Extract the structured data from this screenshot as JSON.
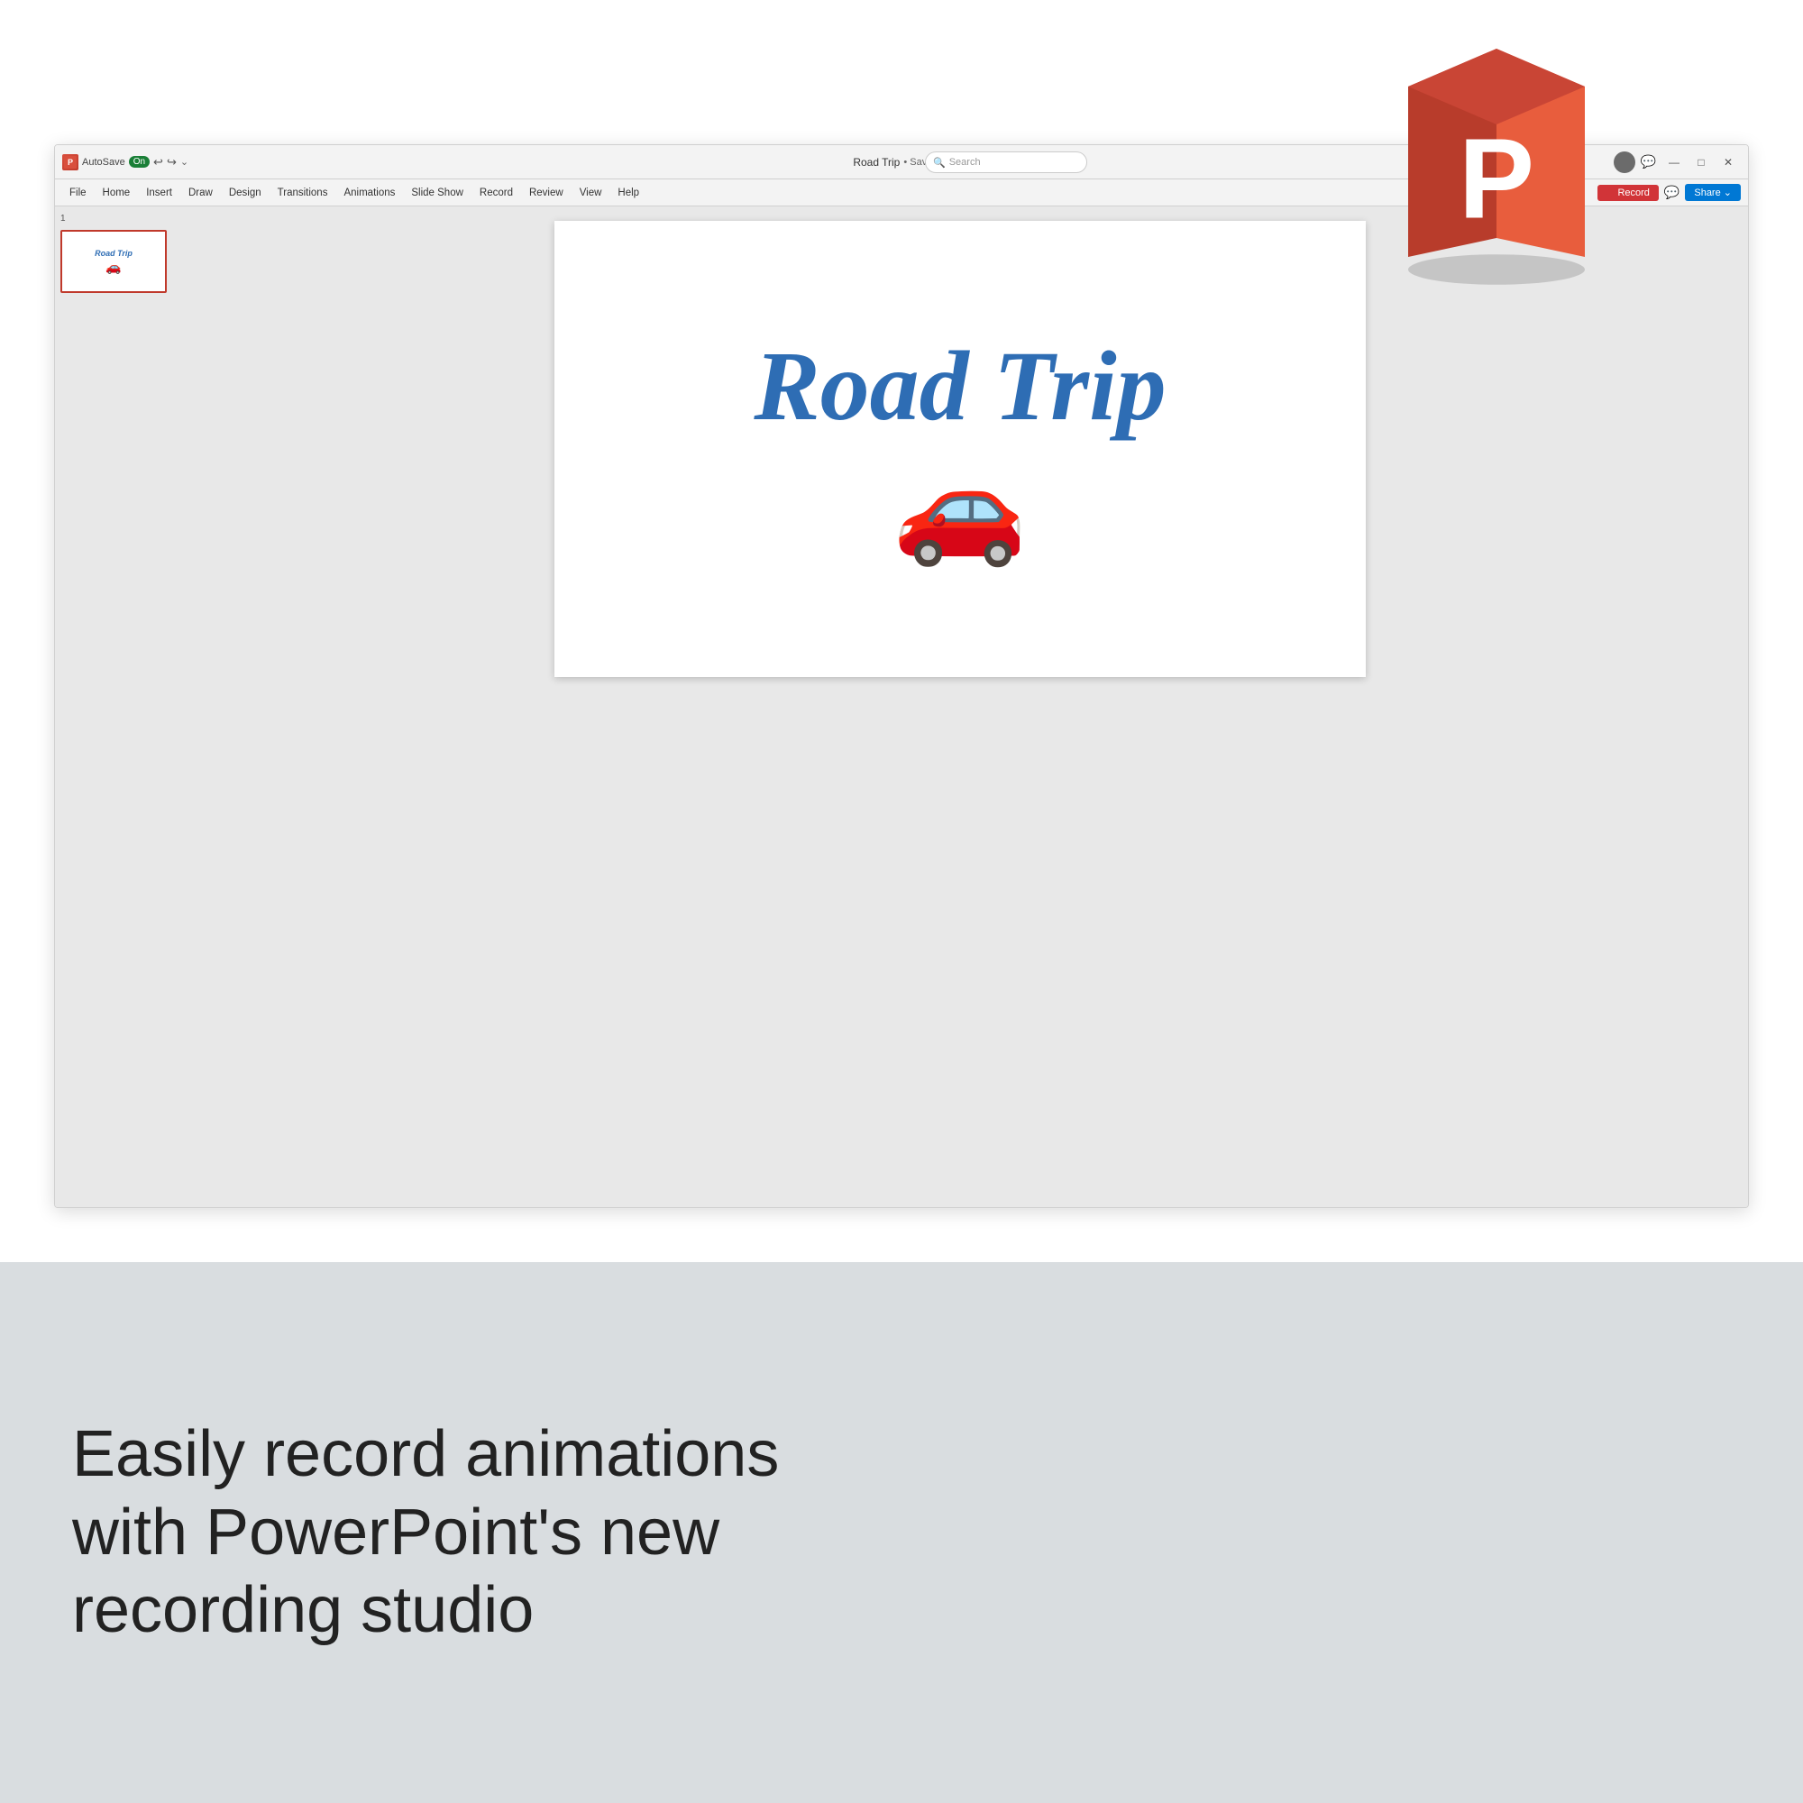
{
  "app": {
    "title": "PowerPoint",
    "icon_letter": "P"
  },
  "titlebar": {
    "autosave_label": "AutoSave",
    "autosave_state": "On",
    "filename": "Road Trip",
    "saved_state": "• Saved",
    "search_placeholder": "Search",
    "minimize_label": "—",
    "maximize_label": "□",
    "close_label": "✕"
  },
  "ribbon": {
    "tabs": [
      {
        "label": "File"
      },
      {
        "label": "Home"
      },
      {
        "label": "Insert"
      },
      {
        "label": "Draw"
      },
      {
        "label": "Design"
      },
      {
        "label": "Transitions"
      },
      {
        "label": "Animations"
      },
      {
        "label": "Slide Show"
      },
      {
        "label": "Record"
      },
      {
        "label": "Review"
      },
      {
        "label": "View"
      },
      {
        "label": "Help"
      }
    ],
    "record_button": "Record",
    "share_button": "Share"
  },
  "slide": {
    "number": "1",
    "title": "Road Trip",
    "car_emoji": "🚗",
    "thumbnail_title": "Road Trip",
    "thumbnail_car": "🚗"
  },
  "bottom": {
    "text": "Easily record animations\nwith PowerPoint's new\nrecording studio"
  }
}
